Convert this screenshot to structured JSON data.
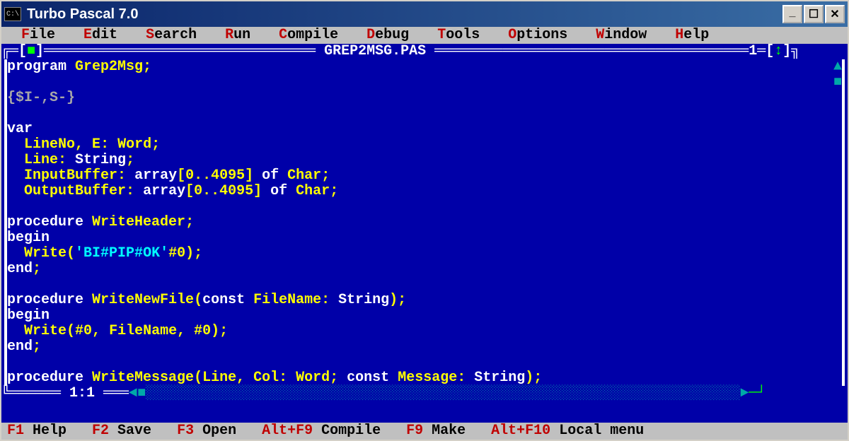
{
  "titlebar": {
    "icon_text": "C:\\",
    "title": "Turbo Pascal 7.0"
  },
  "menu": {
    "file": "File",
    "edit": "Edit",
    "search": "Search",
    "run": "Run",
    "compile": "Compile",
    "debug": "Debug",
    "tools": "Tools",
    "options": "Options",
    "window": "Window",
    "help": "Help"
  },
  "editor": {
    "filename": "GREP2MSG.PAS",
    "window_number": "1",
    "cursor_position": "1:1",
    "lines": [
      {
        "type": "code",
        "tokens": [
          {
            "c": "kw",
            "t": "program "
          },
          {
            "c": "ident",
            "t": "Grep2Msg"
          },
          {
            "c": "sym",
            "t": ";"
          }
        ]
      },
      {
        "type": "blank"
      },
      {
        "type": "code",
        "tokens": [
          {
            "c": "dir",
            "t": "{$I-,S-}"
          }
        ]
      },
      {
        "type": "blank"
      },
      {
        "type": "code",
        "tokens": [
          {
            "c": "kw",
            "t": "var"
          }
        ]
      },
      {
        "type": "code",
        "tokens": [
          {
            "c": "kw",
            "t": "  "
          },
          {
            "c": "ident",
            "t": "LineNo"
          },
          {
            "c": "sym",
            "t": ", "
          },
          {
            "c": "ident",
            "t": "E"
          },
          {
            "c": "sym",
            "t": ": "
          },
          {
            "c": "ident",
            "t": "Word"
          },
          {
            "c": "sym",
            "t": ";"
          }
        ]
      },
      {
        "type": "code",
        "tokens": [
          {
            "c": "kw",
            "t": "  "
          },
          {
            "c": "ident",
            "t": "Line"
          },
          {
            "c": "sym",
            "t": ": "
          },
          {
            "c": "kw",
            "t": "String"
          },
          {
            "c": "sym",
            "t": ";"
          }
        ]
      },
      {
        "type": "code",
        "tokens": [
          {
            "c": "kw",
            "t": "  "
          },
          {
            "c": "ident",
            "t": "InputBuffer"
          },
          {
            "c": "sym",
            "t": ": "
          },
          {
            "c": "kw",
            "t": "array"
          },
          {
            "c": "sym",
            "t": "["
          },
          {
            "c": "ident",
            "t": "0"
          },
          {
            "c": "sym",
            "t": ".."
          },
          {
            "c": "ident",
            "t": "4095"
          },
          {
            "c": "sym",
            "t": "] "
          },
          {
            "c": "kw",
            "t": "of "
          },
          {
            "c": "ident",
            "t": "Char"
          },
          {
            "c": "sym",
            "t": ";"
          }
        ]
      },
      {
        "type": "code",
        "tokens": [
          {
            "c": "kw",
            "t": "  "
          },
          {
            "c": "ident",
            "t": "OutputBuffer"
          },
          {
            "c": "sym",
            "t": ": "
          },
          {
            "c": "kw",
            "t": "array"
          },
          {
            "c": "sym",
            "t": "["
          },
          {
            "c": "ident",
            "t": "0"
          },
          {
            "c": "sym",
            "t": ".."
          },
          {
            "c": "ident",
            "t": "4095"
          },
          {
            "c": "sym",
            "t": "] "
          },
          {
            "c": "kw",
            "t": "of "
          },
          {
            "c": "ident",
            "t": "Char"
          },
          {
            "c": "sym",
            "t": ";"
          }
        ]
      },
      {
        "type": "blank"
      },
      {
        "type": "code",
        "tokens": [
          {
            "c": "kw",
            "t": "procedure "
          },
          {
            "c": "ident",
            "t": "WriteHeader"
          },
          {
            "c": "sym",
            "t": ";"
          }
        ]
      },
      {
        "type": "code",
        "tokens": [
          {
            "c": "kw",
            "t": "begin"
          }
        ]
      },
      {
        "type": "code",
        "tokens": [
          {
            "c": "kw",
            "t": "  "
          },
          {
            "c": "ident",
            "t": "Write"
          },
          {
            "c": "sym",
            "t": "("
          },
          {
            "c": "str",
            "t": "'BI#PIP#OK'"
          },
          {
            "c": "ident",
            "t": "#0"
          },
          {
            "c": "sym",
            "t": ");"
          }
        ]
      },
      {
        "type": "code",
        "tokens": [
          {
            "c": "kw",
            "t": "end"
          },
          {
            "c": "sym",
            "t": ";"
          }
        ]
      },
      {
        "type": "blank"
      },
      {
        "type": "code",
        "tokens": [
          {
            "c": "kw",
            "t": "procedure "
          },
          {
            "c": "ident",
            "t": "WriteNewFile"
          },
          {
            "c": "sym",
            "t": "("
          },
          {
            "c": "kw",
            "t": "const "
          },
          {
            "c": "ident",
            "t": "FileName"
          },
          {
            "c": "sym",
            "t": ": "
          },
          {
            "c": "kw",
            "t": "String"
          },
          {
            "c": "sym",
            "t": ");"
          }
        ]
      },
      {
        "type": "code",
        "tokens": [
          {
            "c": "kw",
            "t": "begin"
          }
        ]
      },
      {
        "type": "code",
        "tokens": [
          {
            "c": "kw",
            "t": "  "
          },
          {
            "c": "ident",
            "t": "Write"
          },
          {
            "c": "sym",
            "t": "("
          },
          {
            "c": "ident",
            "t": "#0"
          },
          {
            "c": "sym",
            "t": ", "
          },
          {
            "c": "ident",
            "t": "FileName"
          },
          {
            "c": "sym",
            "t": ", "
          },
          {
            "c": "ident",
            "t": "#0"
          },
          {
            "c": "sym",
            "t": ");"
          }
        ]
      },
      {
        "type": "code",
        "tokens": [
          {
            "c": "kw",
            "t": "end"
          },
          {
            "c": "sym",
            "t": ";"
          }
        ]
      },
      {
        "type": "blank"
      },
      {
        "type": "code",
        "tokens": [
          {
            "c": "kw",
            "t": "procedure "
          },
          {
            "c": "ident",
            "t": "WriteMessage"
          },
          {
            "c": "sym",
            "t": "("
          },
          {
            "c": "ident",
            "t": "Line"
          },
          {
            "c": "sym",
            "t": ", "
          },
          {
            "c": "ident",
            "t": "Col"
          },
          {
            "c": "sym",
            "t": ": "
          },
          {
            "c": "ident",
            "t": "Word"
          },
          {
            "c": "sym",
            "t": "; "
          },
          {
            "c": "kw",
            "t": "const "
          },
          {
            "c": "ident",
            "t": "Message"
          },
          {
            "c": "sym",
            "t": ": "
          },
          {
            "c": "kw",
            "t": "String"
          },
          {
            "c": "sym",
            "t": ");"
          }
        ]
      }
    ]
  },
  "statusbar": {
    "items": [
      {
        "key": "F1",
        "label": "Help"
      },
      {
        "key": "F2",
        "label": "Save"
      },
      {
        "key": "F3",
        "label": "Open"
      },
      {
        "key": "Alt+F9",
        "label": "Compile"
      },
      {
        "key": "F9",
        "label": "Make"
      },
      {
        "key": "Alt+F10",
        "label": "Local menu"
      }
    ]
  }
}
